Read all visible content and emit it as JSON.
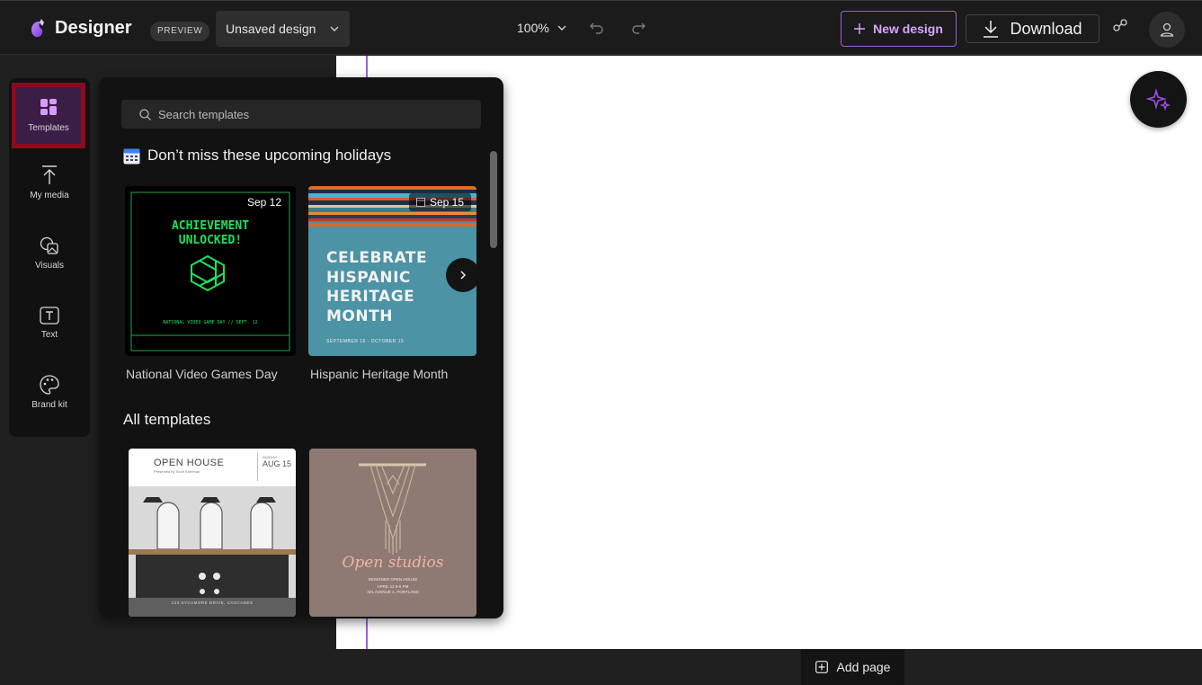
{
  "app": {
    "brand_name": "Designer",
    "preview_label": "PREVIEW",
    "design_name": "Unsaved design",
    "zoom": "100%",
    "new_design_label": "New design",
    "download_label": "Download",
    "add_page_label": "Add page"
  },
  "rail": {
    "items": [
      {
        "label": "Templates",
        "icon": "templates-icon",
        "active": true
      },
      {
        "label": "My media",
        "icon": "upload-icon"
      },
      {
        "label": "Visuals",
        "icon": "visuals-icon"
      },
      {
        "label": "Text",
        "icon": "text-icon"
      },
      {
        "label": "Brand kit",
        "icon": "palette-icon"
      }
    ]
  },
  "panel": {
    "search_placeholder": "Search templates",
    "holidays_title": "Don’t miss these upcoming holidays",
    "all_templates_title": "All templates",
    "holiday_cards": [
      {
        "label": "National Video Games Day",
        "date": "Sep 12",
        "headline_1": "ACHIEVEMENT",
        "headline_2": "UNLOCKED!",
        "footer": "NATIONAL VIDEO GAME DAY // SEPT. 12"
      },
      {
        "label": "Hispanic Heritage Month",
        "date": "Sep 15",
        "headline_lines": [
          "CELEBRATE",
          "HISPANIC",
          "HERITAGE",
          "MONTH"
        ],
        "footer": "SEPTEMBER 15 - OCTOBER 15"
      }
    ],
    "template_cards": [
      {
        "title": "OPEN HOUSE",
        "subtitle": "Presented by Scott Sherman",
        "date_small": "SUNDAY",
        "date": "AUG 15",
        "footer": "123 SYCAMORE DRIVE, CASCADES"
      },
      {
        "script_title": "Open studios",
        "line_1": "DESIGNER OPEN HOUSE",
        "line_2": "APRIL 12 8-6 PM",
        "line_3": "321 AVENUE A, PORTLAND"
      }
    ]
  },
  "colors": {
    "accent": "#a05cd8",
    "accent_text": "#d9a6ff",
    "active_highlight": "#8b0b1c",
    "game_green": "#1fe05a",
    "heritage_teal": "#4b93a5"
  }
}
